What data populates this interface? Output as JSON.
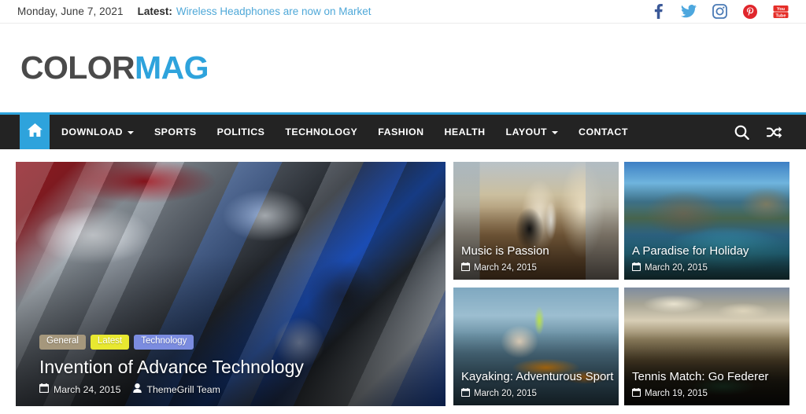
{
  "topbar": {
    "date": "Monday, June 7, 2021",
    "latest_label": "Latest:",
    "latest_link": "Wireless Headphones are now on Market",
    "social": [
      {
        "name": "facebook-icon",
        "color": "#3b5998"
      },
      {
        "name": "twitter-icon",
        "color": "#4da7de"
      },
      {
        "name": "instagram-icon",
        "color": "#4a7ab5"
      },
      {
        "name": "pinterest-icon",
        "color": "#e0262c"
      },
      {
        "name": "youtube-icon",
        "color": "#e52d27"
      }
    ]
  },
  "logo": {
    "part1": "COLOR",
    "part2": "MAG",
    "color1": "#4a4a4a",
    "color2": "#2ea3dc"
  },
  "nav": {
    "accent_color": "#2ea3dc",
    "background": "#232323",
    "home_icon": "home-icon",
    "items": [
      {
        "label": "DOWNLOAD",
        "has_dropdown": true
      },
      {
        "label": "SPORTS",
        "has_dropdown": false
      },
      {
        "label": "POLITICS",
        "has_dropdown": false
      },
      {
        "label": "TECHNOLOGY",
        "has_dropdown": false
      },
      {
        "label": "FASHION",
        "has_dropdown": false
      },
      {
        "label": "HEALTH",
        "has_dropdown": false
      },
      {
        "label": "LAYOUT",
        "has_dropdown": true
      },
      {
        "label": "CONTACT",
        "has_dropdown": false
      }
    ],
    "right_icons": [
      {
        "name": "search-icon"
      },
      {
        "name": "random-post-icon"
      }
    ]
  },
  "feature": {
    "image": "car-engine-photo",
    "badges": [
      {
        "label": "General",
        "color": "#a5977c"
      },
      {
        "label": "Latest",
        "color": "#e8e830",
        "text_color": "#ffffff"
      },
      {
        "label": "Technology",
        "color": "#7b8ce0"
      }
    ],
    "title": "Invention of Advance Technology",
    "date": "March 24, 2015",
    "author": "ThemeGrill Team"
  },
  "cards": [
    {
      "image": "woman-piano-photo",
      "title": "Music is Passion",
      "date": "March 24, 2015",
      "class": "ph-music"
    },
    {
      "image": "coastal-bay-photo",
      "title": "A Paradise for Holiday",
      "date": "March 20, 2015",
      "class": "ph-paradise"
    },
    {
      "image": "kayaker-photo",
      "title": "Kayaking: Adventurous Sport",
      "date": "March 20, 2015",
      "class": "ph-kayak"
    },
    {
      "image": "tennis-stadium-photo",
      "title": "Tennis Match: Go Federer",
      "date": "March 19, 2015",
      "class": "ph-tennis"
    }
  ]
}
